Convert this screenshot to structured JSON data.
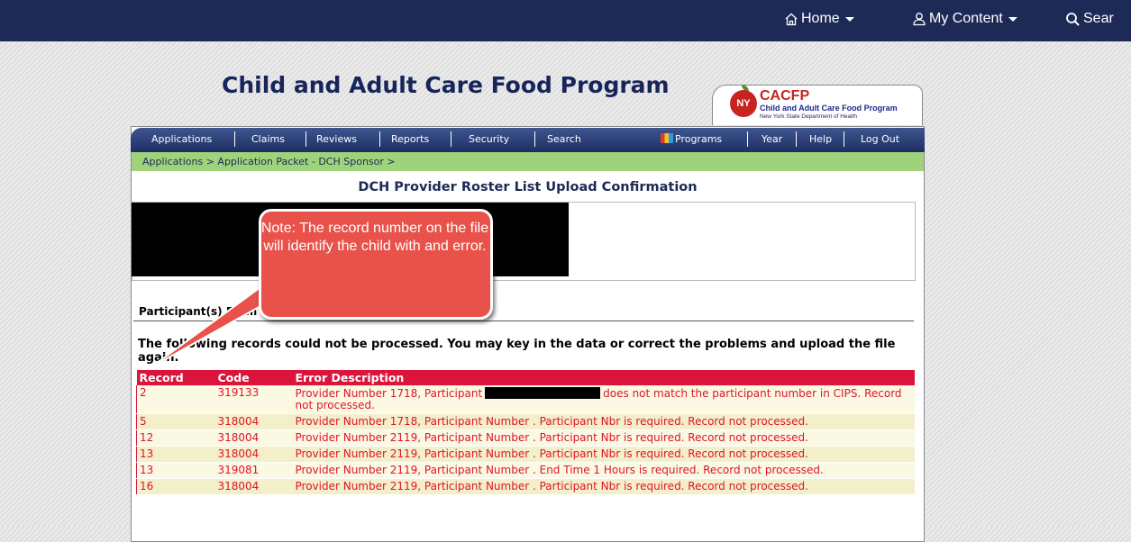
{
  "topnav": {
    "home_label": "Home",
    "mycontent_label": "My Content",
    "search_label": "Sear"
  },
  "header": {
    "title": "Child and Adult Care Food Program",
    "logo": {
      "badge": "NY",
      "main": "CACFP",
      "sub": "Child and Adult Care Food Program",
      "sub2": "New York State Department of Health"
    }
  },
  "menu": {
    "items": [
      "Applications",
      "Claims",
      "Reviews",
      "Reports",
      "Security",
      "Search"
    ],
    "right_items": [
      "Programs",
      "Year",
      "Help",
      "Log Out"
    ]
  },
  "breadcrumb": {
    "item1": "Applications",
    "item2": "Application Packet - DCH Sponsor",
    "sep": " > "
  },
  "page": {
    "title": "DCH Provider Roster List Upload Confirmation",
    "section_label": "Participant(s) Form",
    "message": "The following records could not be processed. You may key in the data or correct the problems and upload the file again."
  },
  "table": {
    "headers": [
      "Record",
      "Code",
      "Error Description"
    ],
    "rows": [
      {
        "record": "2",
        "code": "319133",
        "desc_pre": "Provider Number 1718, Participant",
        "desc_post": "does not match the participant number in CIPS. Record not processed.",
        "redacted": true
      },
      {
        "record": "5",
        "code": "318004",
        "desc_pre": "Provider Number 1718, Participant Number . Participant Nbr is required. Record not processed.",
        "desc_post": "",
        "redacted": false
      },
      {
        "record": "12",
        "code": "318004",
        "desc_pre": "Provider Number 2119, Participant Number . Participant Nbr is required. Record not processed.",
        "desc_post": "",
        "redacted": false
      },
      {
        "record": "13",
        "code": "318004",
        "desc_pre": "Provider Number 2119, Participant Number . Participant Nbr is required. Record not processed.",
        "desc_post": "",
        "redacted": false
      },
      {
        "record": "13",
        "code": "319081",
        "desc_pre": "Provider Number 2119, Participant Number . End Time 1 Hours is required. Record not processed.",
        "desc_post": "",
        "redacted": false
      },
      {
        "record": "16",
        "code": "318004",
        "desc_pre": "Provider Number 2119, Participant Number . Participant Nbr is required. Record not processed.",
        "desc_post": "",
        "redacted": false
      }
    ]
  },
  "callout": {
    "text": "Note: The record number on the file will identify the child with and error."
  },
  "colors": {
    "topbar": "#1d2a56",
    "menubar": "#2a3f78",
    "breadcrumb_bar": "#9fd37b",
    "table_header": "#dc143c",
    "error_text": "#e0152a",
    "callout": "#e8524a"
  }
}
